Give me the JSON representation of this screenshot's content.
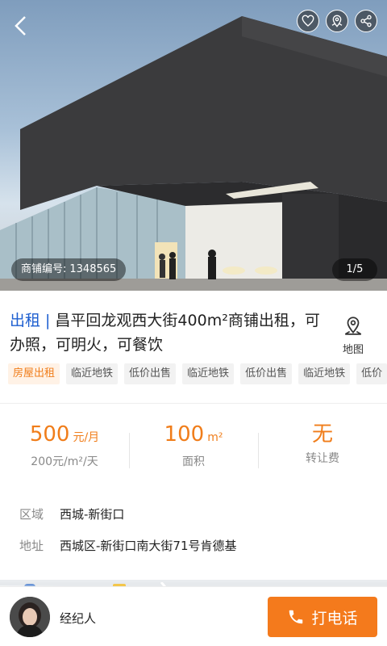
{
  "hero": {
    "shop_code_label": "商铺编号:",
    "shop_code": "1348565",
    "photo_counter": "1/5"
  },
  "icons": {
    "back": "back-arrow-icon",
    "favorite": "heart-icon",
    "location_pin": "pin-icon",
    "share": "share-icon",
    "map": "map-pin-icon",
    "call": "phone-icon"
  },
  "listing": {
    "type": "出租",
    "title": "昌平回龙观西大街400m²商铺出租，可办照，可明火，可餐饮",
    "map_label": "地图"
  },
  "tags": [
    "房屋出租",
    "临近地铁",
    "低价出售",
    "临近地铁",
    "低价出售",
    "临近地铁",
    "低价"
  ],
  "stats": {
    "rent": {
      "value": "500",
      "unit": "元/月",
      "sub": "200元/m²/天"
    },
    "area": {
      "value": "100",
      "unit": "m²",
      "sub": "面积"
    },
    "transfer": {
      "value": "无",
      "sub": "转让费"
    }
  },
  "info": {
    "district_label": "区域",
    "district_value": "西城-新街口",
    "address_label": "地址",
    "address_value": "西城区-新街口南大街71号肯德基"
  },
  "bottom": {
    "agent_label": "经纪人",
    "call_label": "打电话"
  },
  "colors": {
    "accent": "#f47a1c",
    "price": "#f07d1a",
    "type_blue": "#1e5fd0"
  }
}
